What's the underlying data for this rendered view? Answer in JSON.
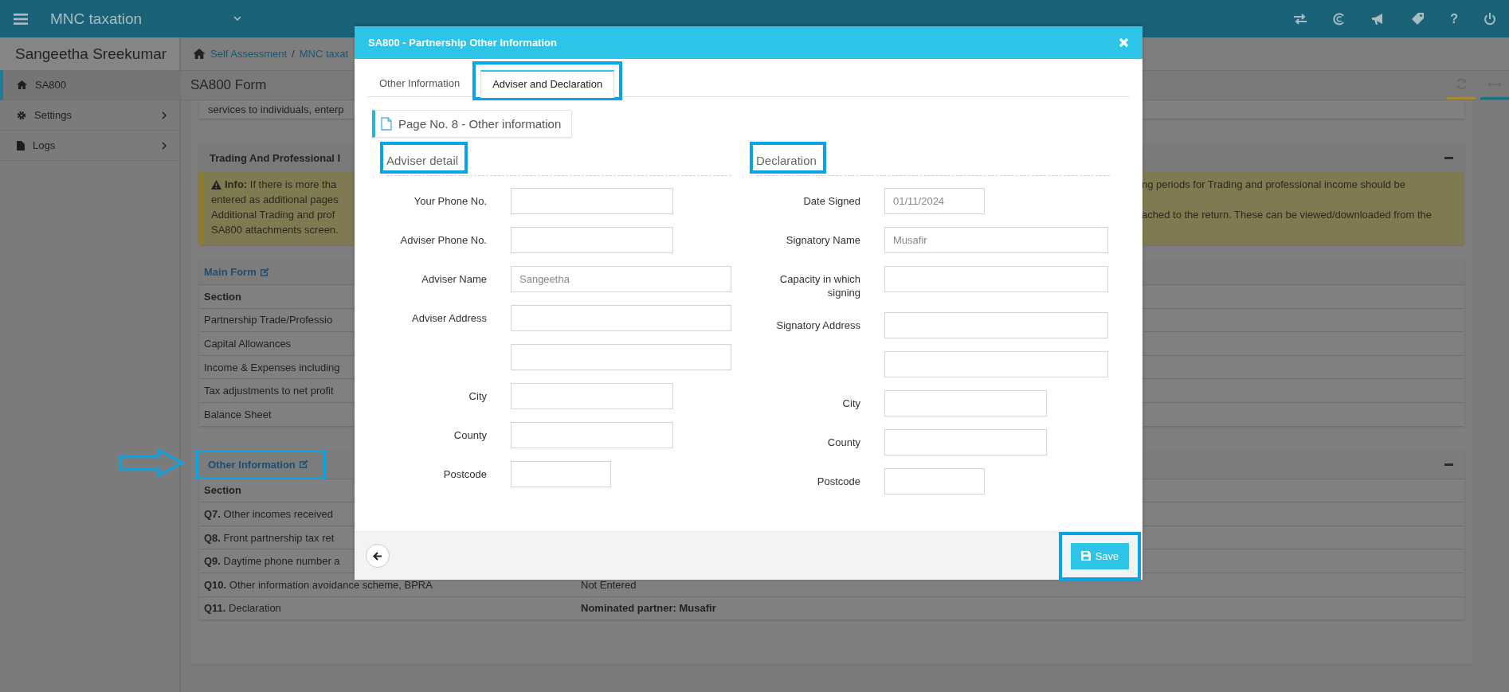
{
  "top_bar": {
    "app_name": "MNC taxation",
    "help_label": "?"
  },
  "sidebar": {
    "user_name": "Sangeetha Sreekumar",
    "items": [
      {
        "label": "SA800",
        "kind": "home",
        "selected": true,
        "has_submenu": false
      },
      {
        "label": "Settings",
        "kind": "settings",
        "selected": false,
        "has_submenu": true
      },
      {
        "label": "Logs",
        "kind": "logs",
        "selected": false,
        "has_submenu": true
      }
    ]
  },
  "breadcrumb": [
    "Self Assessment",
    "MNC taxat"
  ],
  "breadcrumb_separator": "/",
  "page_title": "SA800 Form",
  "intro_text": "services to individuals, enterp",
  "trading_panel": {
    "title": "Trading And Professional I",
    "info_lines": [
      {
        "left": "**Info:** If there is more tha",
        "right": "ng periods for Trading and professional income should be"
      },
      {
        "left": "entered as additional pages"
      },
      {
        "left": "Additional Trading and prof",
        "right": "ached to the return. These can be viewed/downloaded from the"
      },
      {
        "left": "SA800 attachments screen."
      }
    ]
  },
  "main_form": {
    "title": "Main Form",
    "header": "Section",
    "rows": [
      "Partnership Trade/Professio",
      "Capital Allowances",
      "Income & Expenses including",
      "Tax adjustments to net profit",
      "Balance Sheet"
    ]
  },
  "other_information": {
    "title": "Other Information",
    "header": "Section",
    "rows": [
      {
        "number": "Q7.",
        "text": "Other incomes received"
      },
      {
        "number": "Q8.",
        "text": "Front partnership tax ret"
      },
      {
        "number": "Q9.",
        "text": "Daytime phone number a"
      },
      {
        "number": "Q10.",
        "text": "Other information avoidance scheme, BPRA",
        "value": "Not Entered",
        "value_bold": false
      },
      {
        "number": "Q11.",
        "text": "Declaration",
        "value": "Nominated partner: Musafir",
        "value_bold": true
      }
    ]
  },
  "modal": {
    "title": "SA800 - Partnership Other Information",
    "tabs": [
      {
        "label": "Other Information",
        "selected": false
      },
      {
        "label": "Adviser and Declaration",
        "selected": true
      }
    ],
    "page_label": "Page No. 8 - Other information",
    "sections": [
      {
        "heading": "Adviser detail",
        "fields": [
          {
            "label": "Your Phone No.",
            "kind": "phone"
          },
          {
            "label": "Adviser Phone No.",
            "kind": "phone"
          },
          {
            "label": "Adviser Name",
            "kind": "name",
            "value": "Sangeetha"
          },
          {
            "label": "Adviser Address",
            "kind": "address"
          },
          {
            "kind": "address"
          },
          {
            "label": "City",
            "kind": "city"
          },
          {
            "label": "County",
            "kind": "county"
          },
          {
            "label": "Postcode",
            "kind": "postcode"
          }
        ]
      },
      {
        "heading": "Declaration",
        "fields": [
          {
            "label": "Date Signed",
            "kind": "date",
            "value": "01/11/2024"
          },
          {
            "label": "Signatory Name",
            "kind": "name",
            "value": "Musafir"
          },
          {
            "label": "Capacity in which signing",
            "kind": "name"
          },
          {
            "label": "Signatory Address",
            "kind": "address"
          },
          {
            "kind": "address"
          },
          {
            "label": "City",
            "kind": "city"
          },
          {
            "label": "County",
            "kind": "county"
          },
          {
            "label": "Postcode",
            "kind": "postcode"
          }
        ]
      }
    ],
    "save_label": "Save"
  }
}
